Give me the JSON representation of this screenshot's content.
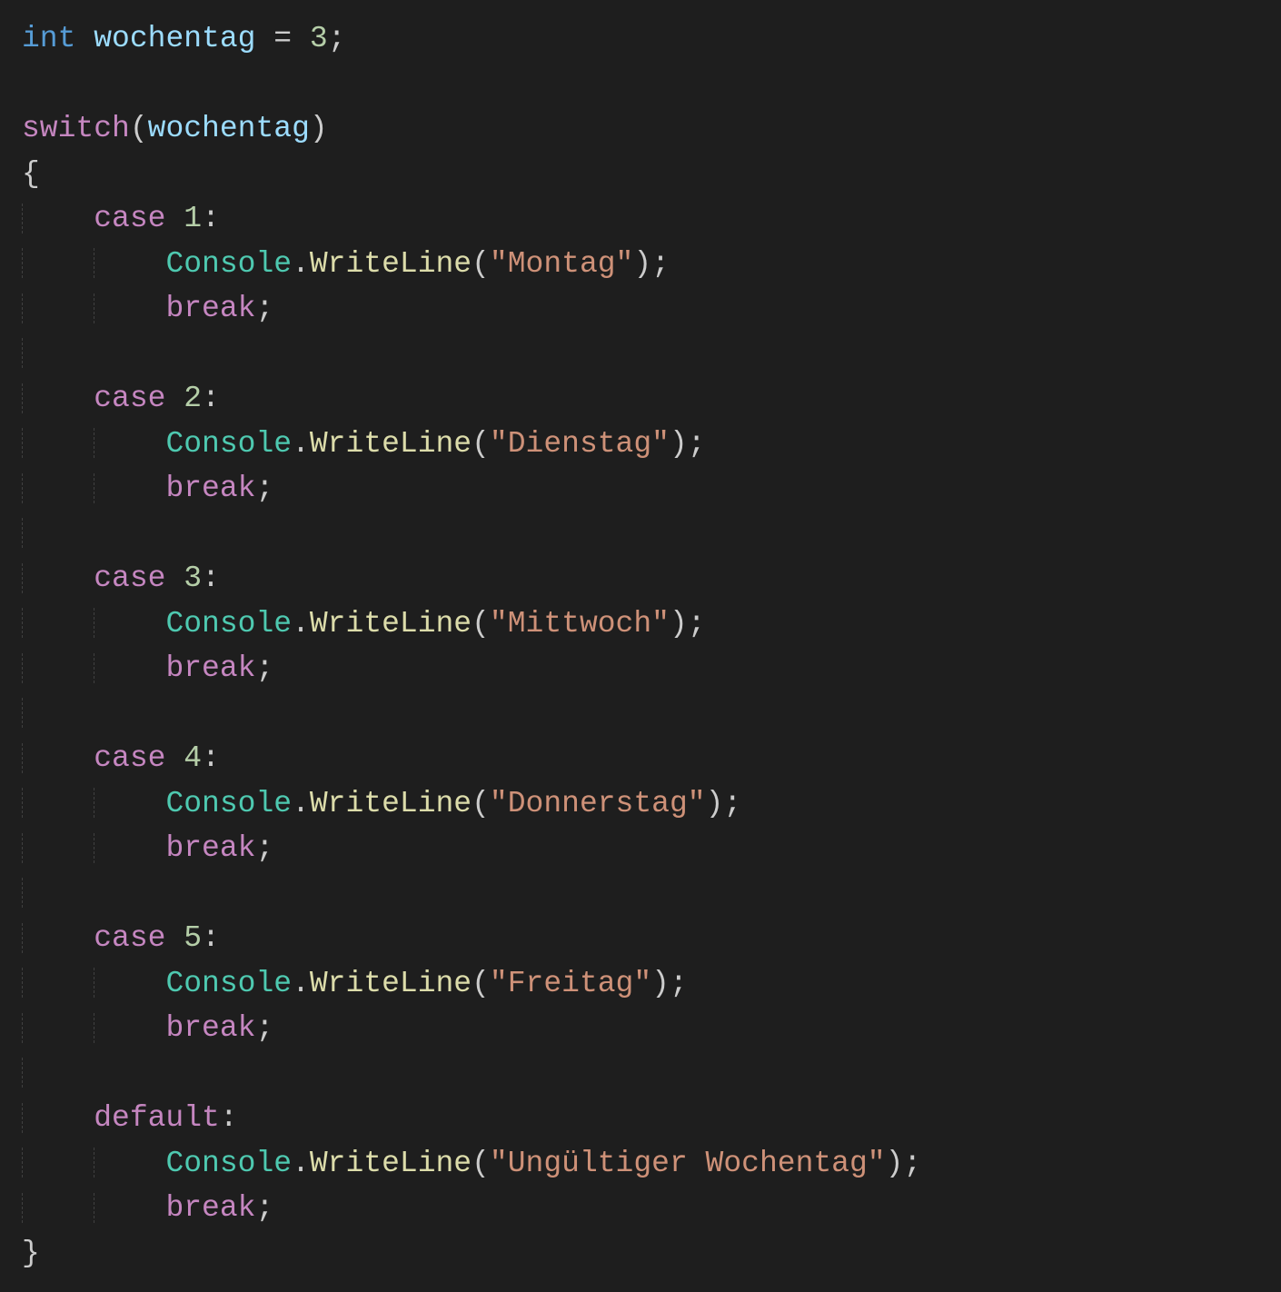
{
  "code": {
    "varType": "int",
    "varName": "wochentag",
    "assignOp": "=",
    "varValue": "3",
    "semicolon": ";",
    "switchKw": "switch",
    "openParen": "(",
    "closeParen": ")",
    "openBrace": "{",
    "closeBrace": "}",
    "caseKw": "case",
    "defaultKw": "default",
    "colon": ":",
    "consoleClass": "Console",
    "dot": ".",
    "writeLine": "WriteLine",
    "breakKw": "break",
    "cases": [
      {
        "num": "1",
        "str": "\"Montag\""
      },
      {
        "num": "2",
        "str": "\"Dienstag\""
      },
      {
        "num": "3",
        "str": "\"Mittwoch\""
      },
      {
        "num": "4",
        "str": "\"Donnerstag\""
      },
      {
        "num": "5",
        "str": "\"Freitag\""
      }
    ],
    "defaultStr": "\"Ungültiger Wochentag\""
  }
}
